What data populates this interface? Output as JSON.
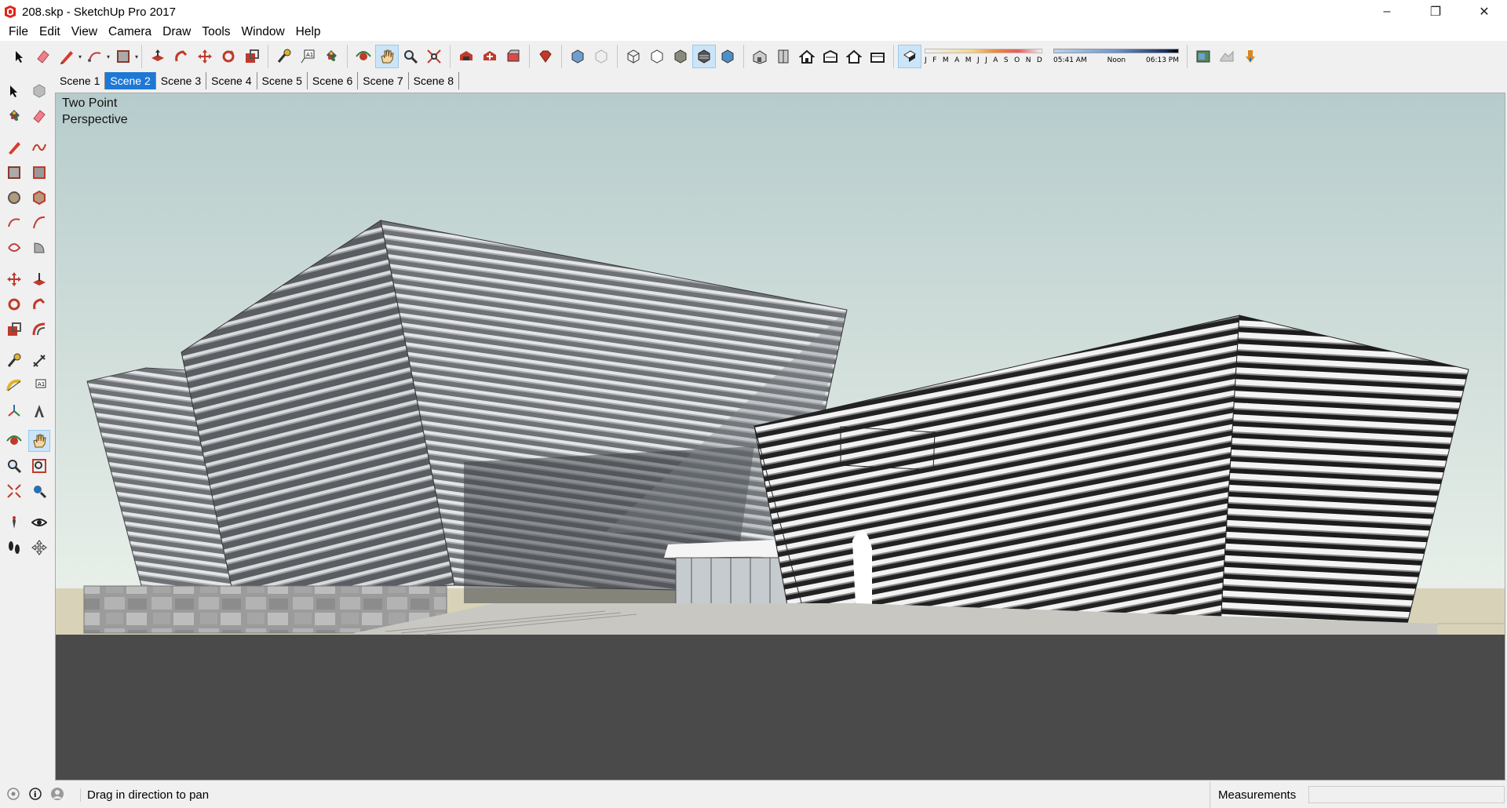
{
  "window": {
    "title": "208.skp - SketchUp Pro 2017"
  },
  "menu": [
    "File",
    "Edit",
    "View",
    "Camera",
    "Draw",
    "Tools",
    "Window",
    "Help"
  ],
  "toolbar": {
    "shadow_months": [
      "J",
      "F",
      "M",
      "A",
      "M",
      "J",
      "J",
      "A",
      "S",
      "O",
      "N",
      "D"
    ],
    "shadow_time_start": "05:41 AM",
    "shadow_time_mid": "Noon",
    "shadow_time_end": "06:13 PM"
  },
  "scenes": {
    "tabs": [
      "Scene 1",
      "Scene 2",
      "Scene 3",
      "Scene 4",
      "Scene 5",
      "Scene 6",
      "Scene 7",
      "Scene 8"
    ],
    "active": "Scene 2"
  },
  "viewport": {
    "camera_line1": "Two Point",
    "camera_line2": "Perspective"
  },
  "status": {
    "hint": "Drag in direction to pan",
    "measurements_label": "Measurements",
    "measurements_value": ""
  },
  "colors": {
    "active_tab": "#1e78d6",
    "sky_top": "#b6cccc",
    "sky_bottom": "#e8efe9",
    "ground": "#4a4a4a",
    "sand": "#d8d2b8"
  }
}
